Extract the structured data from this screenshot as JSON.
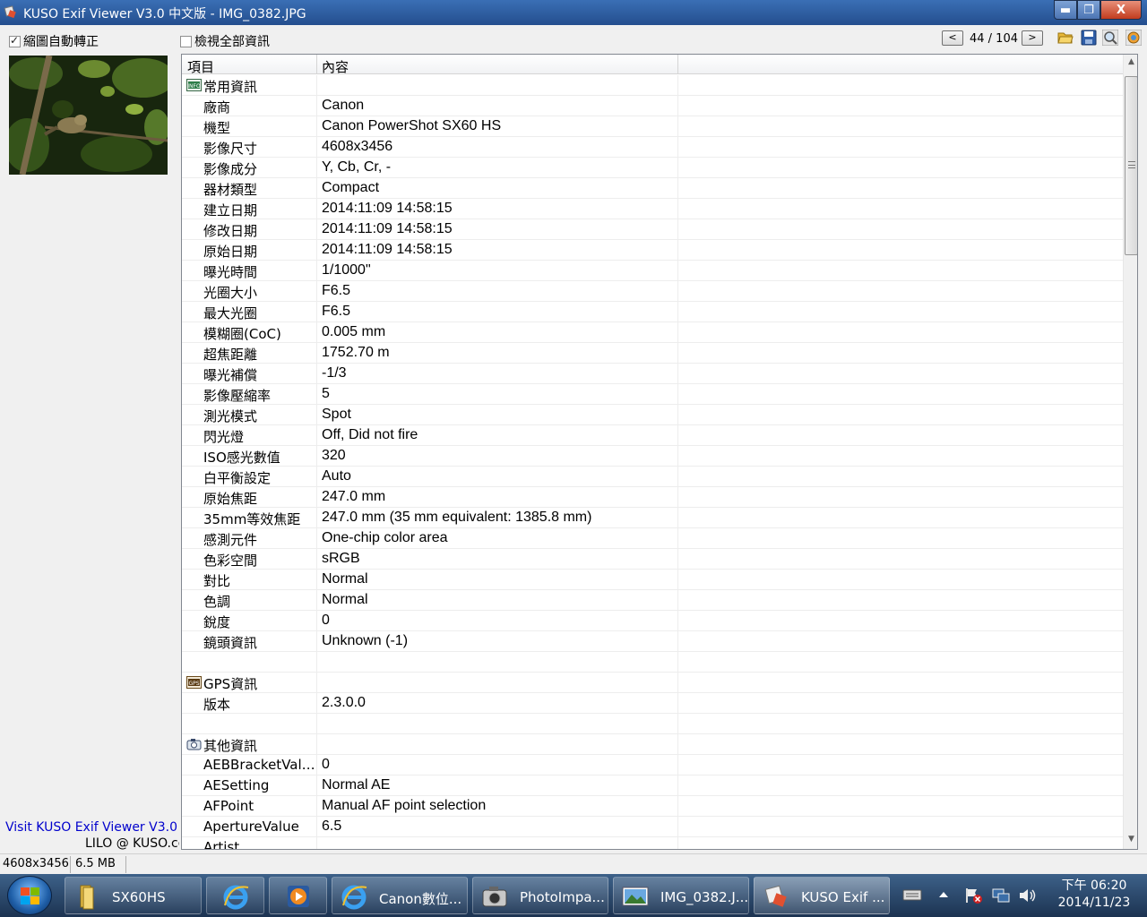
{
  "window": {
    "title": "KUSO Exif Viewer V3.0 中文版 - IMG_0382.JPG",
    "min_symbol": "▬",
    "max_symbol": "❐",
    "close_symbol": "X"
  },
  "left_panel": {
    "auto_rotate_label": "縮圖自動轉正",
    "auto_rotate_checked": true,
    "visit_link": "Visit KUSO Exif Viewer V3.0",
    "credit": "LILO @ KUSO.cc"
  },
  "toolbar": {
    "show_all_label": "檢視全部資訊",
    "show_all_checked": false,
    "prev_label": "<",
    "next_label": ">",
    "counter": "44 / 104",
    "icons": [
      "open-folder-icon",
      "save-icon",
      "zoom-icon",
      "about-icon"
    ]
  },
  "list": {
    "col_item": "項目",
    "col_content": "內容",
    "rows": [
      {
        "type": "cat",
        "icon": "info-icon",
        "item": "常用資訊",
        "value": ""
      },
      {
        "item": "廠商",
        "value": "Canon"
      },
      {
        "item": "機型",
        "value": "Canon PowerShot SX60 HS"
      },
      {
        "item": "影像尺寸",
        "value": "4608x3456"
      },
      {
        "item": "影像成分",
        "value": "Y, Cb, Cr, -"
      },
      {
        "item": "器材類型",
        "value": "Compact"
      },
      {
        "item": "建立日期",
        "value": "2014:11:09 14:58:15"
      },
      {
        "item": "修改日期",
        "value": "2014:11:09 14:58:15"
      },
      {
        "item": "原始日期",
        "value": "2014:11:09 14:58:15"
      },
      {
        "item": "曝光時間",
        "value": "1/1000\""
      },
      {
        "item": "光圈大小",
        "value": "F6.5"
      },
      {
        "item": "最大光圈",
        "value": "F6.5"
      },
      {
        "item": "模糊圈(CoC)",
        "value": "0.005 mm"
      },
      {
        "item": "超焦距離",
        "value": "1752.70 m"
      },
      {
        "item": "曝光補償",
        "value": "-1/3"
      },
      {
        "item": "影像壓縮率",
        "value": "5"
      },
      {
        "item": "測光模式",
        "value": "Spot"
      },
      {
        "item": "閃光燈",
        "value": "Off, Did not fire"
      },
      {
        "item": "ISO感光數值",
        "value": "320"
      },
      {
        "item": "白平衡設定",
        "value": "Auto"
      },
      {
        "item": "原始焦距",
        "value": "247.0 mm"
      },
      {
        "item": "35mm等效焦距",
        "value": "247.0 mm (35 mm equivalent: 1385.8 mm)"
      },
      {
        "item": "感測元件",
        "value": "One-chip color area"
      },
      {
        "item": "色彩空間",
        "value": "sRGB"
      },
      {
        "item": "對比",
        "value": "Normal"
      },
      {
        "item": "色調",
        "value": "Normal"
      },
      {
        "item": "銳度",
        "value": "0"
      },
      {
        "item": "鏡頭資訊",
        "value": "Unknown (-1)"
      },
      {
        "type": "blank",
        "item": "",
        "value": ""
      },
      {
        "type": "cat",
        "icon": "gps-icon",
        "item": "GPS資訊",
        "value": ""
      },
      {
        "item": "版本",
        "value": "2.3.0.0"
      },
      {
        "type": "blank",
        "item": "",
        "value": ""
      },
      {
        "type": "cat",
        "icon": "camera-icon",
        "item": "其他資訊",
        "value": ""
      },
      {
        "item": "AEBBracketValue",
        "value": "0"
      },
      {
        "item": "AESetting",
        "value": "Normal AE"
      },
      {
        "item": "AFPoint",
        "value": "Manual AF point selection"
      },
      {
        "item": "ApertureValue",
        "value": "6.5"
      },
      {
        "item": "Artist",
        "value": ""
      }
    ]
  },
  "status": {
    "dimensions": "4608x3456",
    "filesize": "6.5 MB"
  },
  "taskbar": {
    "buttons": [
      {
        "icon": "folder-icon",
        "label": "SX60HS"
      },
      {
        "icon": "ie-icon",
        "label": ""
      },
      {
        "icon": "media-player-icon",
        "label": ""
      },
      {
        "icon": "ie-icon",
        "label": "Canon數位..."
      },
      {
        "icon": "camera-icon",
        "label": "PhotoImpa..."
      },
      {
        "icon": "image-icon",
        "label": "IMG_0382.J..."
      },
      {
        "icon": "kuso-icon",
        "label": "KUSO Exif ..."
      }
    ],
    "clock_time": "下午 06:20",
    "clock_date": "2014/11/23"
  },
  "colors": {
    "titlebar": "#2f5f9f",
    "link": "#0000cc",
    "taskbar": "#2a4a70"
  }
}
